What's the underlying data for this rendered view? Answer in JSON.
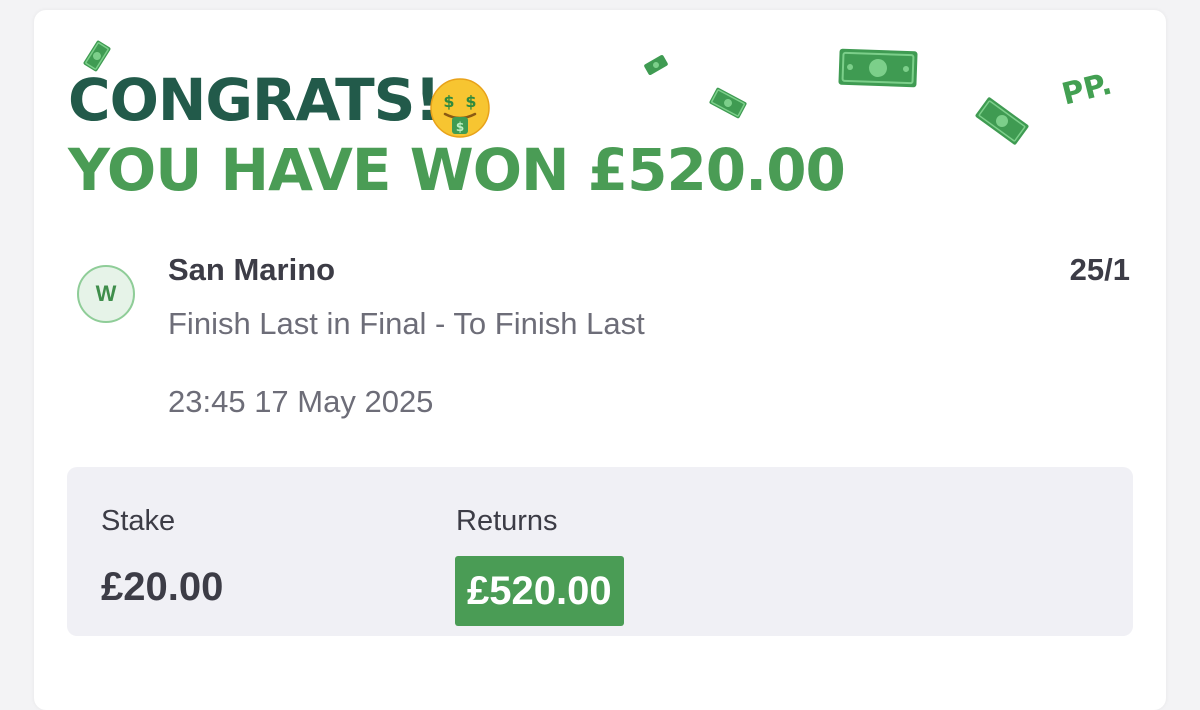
{
  "header": {
    "line1": "CONGRATS!",
    "emoji": "money-mouth-face",
    "line2": "YOU HAVE WON £520.00",
    "brand": "PP."
  },
  "colors": {
    "dark_green": "#225a4a",
    "green": "#4a9c55",
    "summary_bg": "#f0f0f5"
  },
  "bet": {
    "result_badge": "W",
    "selection": "San Marino",
    "odds": "25/1",
    "market": "Finish Last in Final - To Finish Last",
    "datetime": "23:45 17 May 2025"
  },
  "summary": {
    "stake_label": "Stake",
    "stake_value": "£20.00",
    "returns_label": "Returns",
    "returns_value": "£520.00"
  }
}
